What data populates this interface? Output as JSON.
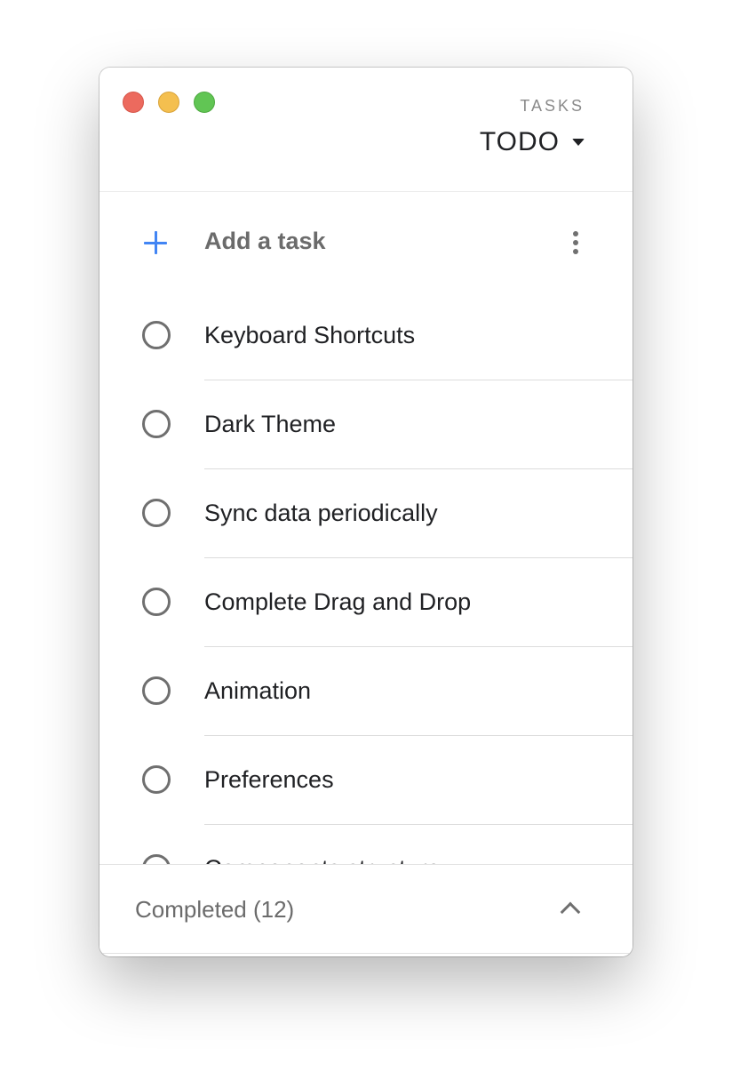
{
  "window": {
    "controls": [
      "close",
      "minimize",
      "maximize"
    ]
  },
  "header": {
    "kicker": "TASKS",
    "list_name": "TODO"
  },
  "add_task": {
    "label": "Add a task",
    "icon": "plus-icon",
    "menu_icon": "more-vert-icon",
    "accent_color": "#4285f4"
  },
  "tasks": [
    {
      "title": "Keyboard Shortcuts"
    },
    {
      "title": "Dark Theme"
    },
    {
      "title": "Sync data periodically"
    },
    {
      "title": "Complete Drag and Drop"
    },
    {
      "title": "Animation"
    },
    {
      "title": "Preferences"
    },
    {
      "title": "Components structure"
    }
  ],
  "footer": {
    "completed_label": "Completed (12)",
    "toggle_icon": "chevron-up-icon"
  }
}
